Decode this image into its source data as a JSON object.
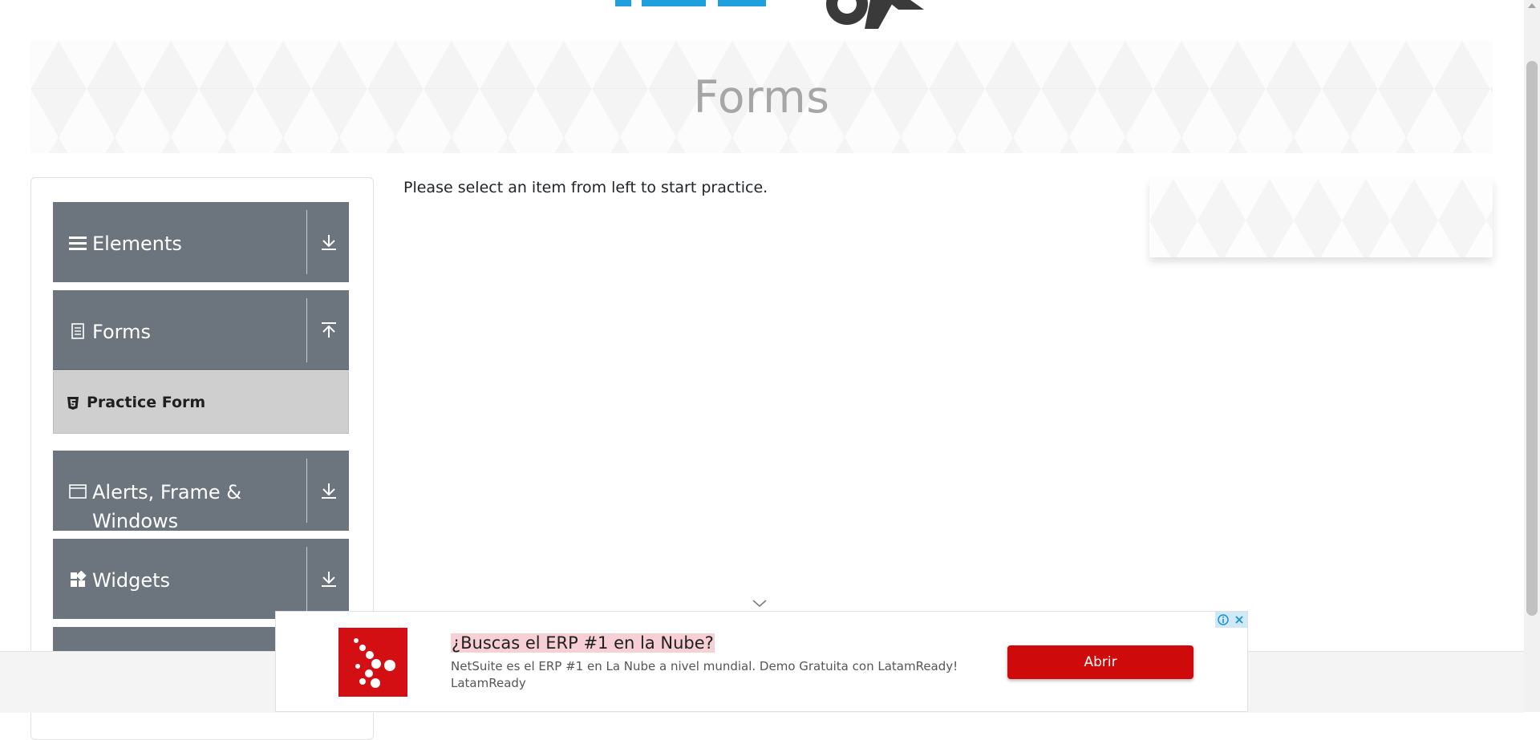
{
  "page": {
    "title": "Forms",
    "main_message": "Please select an item from left to start practice."
  },
  "sidebar": {
    "groups": [
      {
        "label": "Elements",
        "icon": "hamburger-icon",
        "state": "collapsed"
      },
      {
        "label": "Forms",
        "icon": "document-icon",
        "state": "expanded"
      },
      {
        "label": "Alerts, Frame & Windows",
        "icon": "window-icon",
        "state": "collapsed"
      },
      {
        "label": "Widgets",
        "icon": "widgets-icon",
        "state": "collapsed"
      }
    ],
    "forms_items": [
      {
        "label": "Practice Form",
        "icon": "html5-icon"
      }
    ]
  },
  "ad": {
    "headline": "¿Buscas el ERP #1 en la Nube?",
    "description": "NetSuite es el ERP #1 en La Nube a nivel mundial. Demo Gratuita con LatamReady! LatamReady",
    "button": "Abrir",
    "brand_color": "#d40f14"
  },
  "colors": {
    "sidebar_group_bg": "#6c757d",
    "submenu_bg": "#cfcfcf",
    "title_color": "#a6a6a6",
    "logo_blue": "#1ea0dc",
    "logo_dark": "#3a3a3a"
  }
}
